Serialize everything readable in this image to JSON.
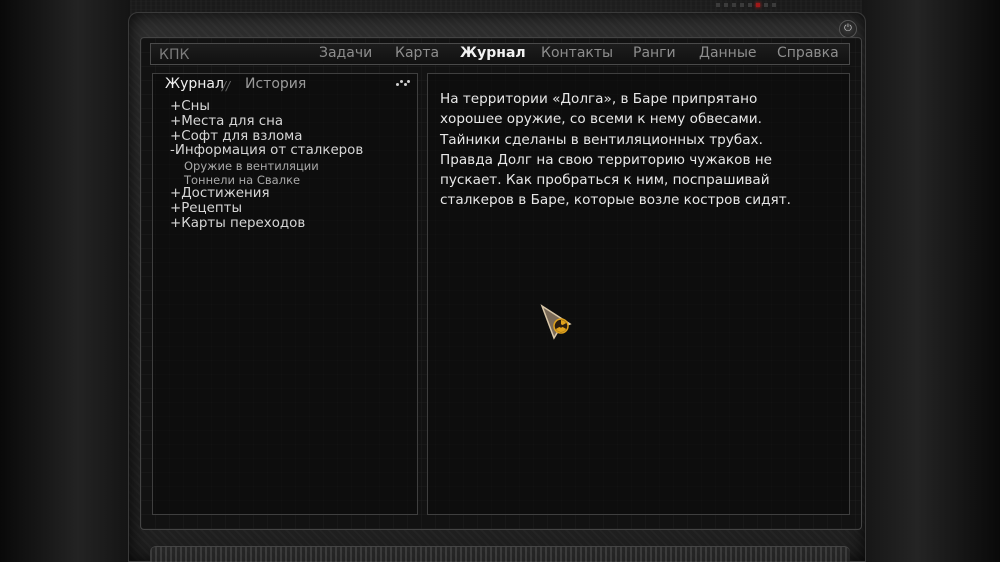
{
  "menubar": {
    "title": "КПК",
    "tabs": [
      {
        "label": "Задачи",
        "active": false
      },
      {
        "label": "Карта",
        "active": false
      },
      {
        "label": "Журнал",
        "active": true
      },
      {
        "label": "Контакты",
        "active": false
      },
      {
        "label": "Ранги",
        "active": false
      },
      {
        "label": "Данные",
        "active": false
      },
      {
        "label": "Справка",
        "active": false
      }
    ]
  },
  "journal": {
    "tabs": [
      {
        "label": "Журнал",
        "active": true
      },
      {
        "label": "История",
        "active": false
      }
    ],
    "separator": "//",
    "tree": [
      {
        "label": "+Сны"
      },
      {
        "label": "+Места для сна"
      },
      {
        "label": "+Софт для взлома"
      },
      {
        "label": "-Информация от сталкеров",
        "children": [
          "Оружие в вентиляции",
          "Тоннели на Свалке"
        ]
      },
      {
        "label": "+Достижения"
      },
      {
        "label": "+Рецепты"
      },
      {
        "label": "+Карты переходов"
      }
    ]
  },
  "article": {
    "text": "На территории «Долга», в Баре припрятано\nхорошее оружие, со всеми к нему обвесами.\nТайники сделаны в вентиляционных трубах.\nПравда Долг на свою территорию чужаков не\nпускает. Как пробраться к ним, поспрашивай\nсталкеров в Баре, которые возле костров сидят."
  },
  "icons": {
    "power": "power-icon",
    "options": "dots-icon",
    "cursor": "radiation-cursor-icon"
  },
  "colors": {
    "active_tab": "#f2f2f2",
    "inactive_tab": "#8d8d8d",
    "cursor_accent": "#e0a21c"
  }
}
